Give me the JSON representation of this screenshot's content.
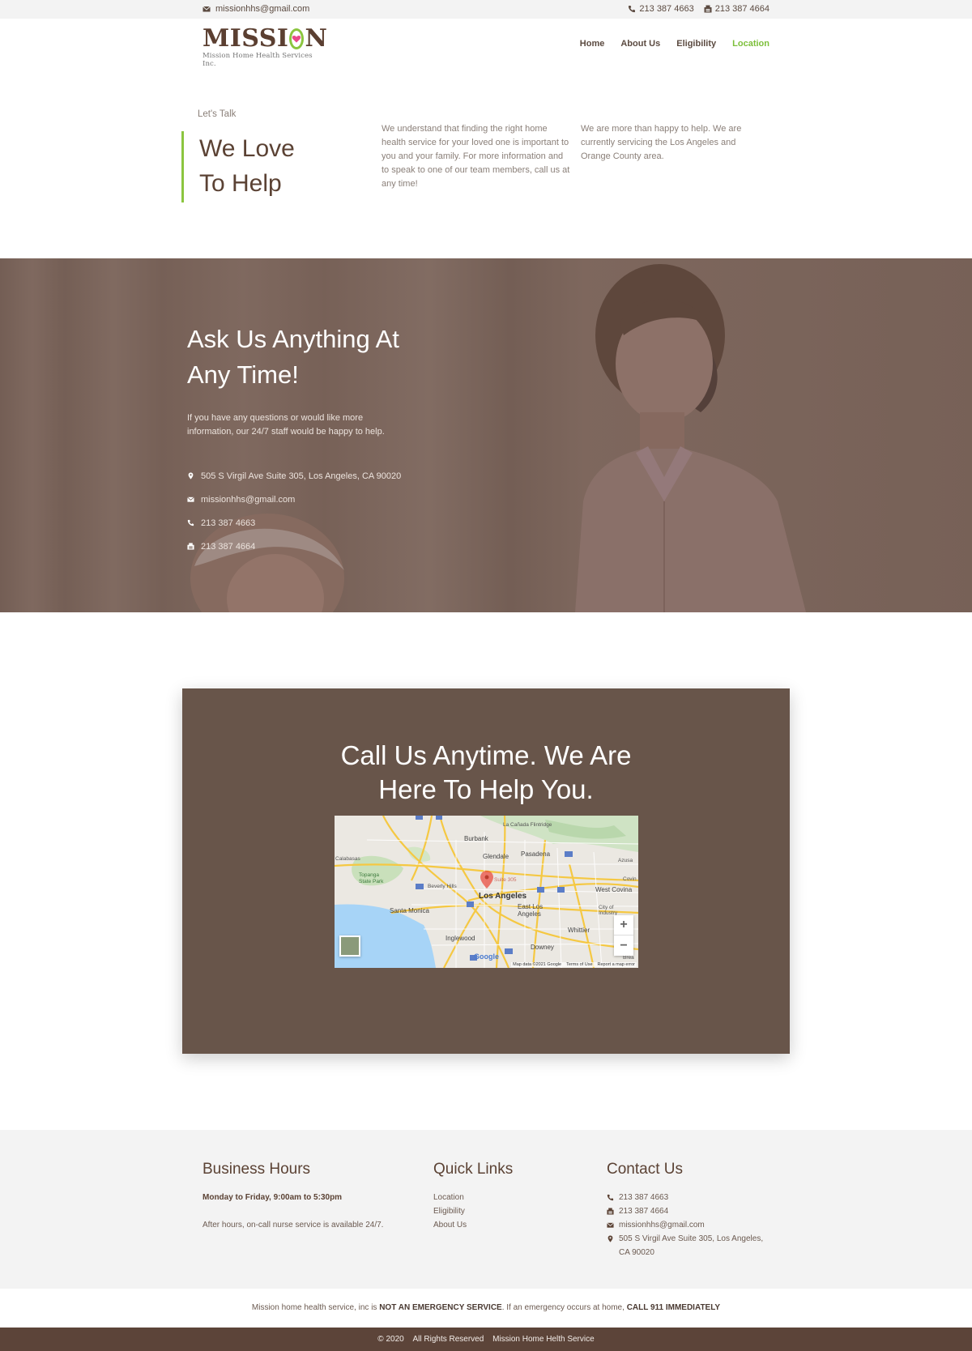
{
  "topbar": {
    "email": "missionhhs@gmail.com",
    "phone": "213 387 4663",
    "fax": "213 387 4664"
  },
  "header": {
    "logo_word_left": "MISSI",
    "logo_word_right": "N",
    "logo_tagline": "Mission Home Health Services Inc.",
    "nav": [
      {
        "label": "Home"
      },
      {
        "label": "About Us"
      },
      {
        "label": "Eligibility"
      },
      {
        "label": "Location"
      }
    ],
    "active_nav": "Location"
  },
  "intro": {
    "eyebrow": "Let's Talk",
    "title_line1": "We Love",
    "title_line2": "To Help",
    "col1": "We understand that finding the right home health service for your loved one is important to you and your family. For more information and to speak to one of our team members, call us at any time!",
    "col2": "We are more than happy to help. We are currently servicing the Los Angeles and Orange County area."
  },
  "hero": {
    "heading_line1": "Ask Us Anything At",
    "heading_line2": "Any Time!",
    "description": "If you have any questions or would like more information, our 24/7 staff would be happy to help.",
    "address": "505 S Virgil Ave Suite 305, Los Angeles, CA 90020",
    "email": "missionhhs@gmail.com",
    "phone": "213 387 4663",
    "fax": "213 387 4664"
  },
  "call": {
    "heading_line1": "Call Us Anytime. We Are",
    "heading_line2": "Here To Help You.",
    "map": {
      "labels": {
        "la_canada": "La Cañada Flintridge",
        "burbank": "Burbank",
        "glendale": "Glendale",
        "pasadena": "Pasadena",
        "calabasas": "Calabasas",
        "azusa": "Azusa",
        "topanga": "Topanga State Park",
        "beverly_hills": "Beverly Hills",
        "suite": "Suite 305",
        "covina": "Covin",
        "west_covina": "West Covina",
        "los_angeles": "Los Angeles",
        "santa_monica": "Santa Monica",
        "east_la": "East Los Angeles",
        "city_industry": "City of Industry",
        "inglewood": "Inglewood",
        "whittier": "Whittier",
        "downey": "Downey",
        "brea": "Brea"
      },
      "zoom_in": "+",
      "zoom_out": "−",
      "google": "Google",
      "attribution": [
        "Map data ©2021 Google",
        "Terms of Use",
        "Report a map error"
      ]
    }
  },
  "footer": {
    "hours_title": "Business Hours",
    "hours_main": "Monday to Friday, 9:00am to 5:30pm",
    "hours_note": "After hours, on-call nurse service is available 24/7.",
    "links_title": "Quick Links",
    "links": [
      {
        "label": "Location"
      },
      {
        "label": "Eligibility"
      },
      {
        "label": "About Us"
      }
    ],
    "contact_title": "Contact Us",
    "contact_phone": "213 387 4663",
    "contact_fax": "213 387 4664",
    "contact_email": "missionhhs@gmail.com",
    "contact_address_line1": "505 S Virgil Ave Suite 305, Los Angeles,",
    "contact_address_line2": "CA 90020"
  },
  "disclaimer": {
    "part1": "Mission home health service, inc is ",
    "bold1": "NOT AN EMERGENCY SERVICE",
    "part2": ". If an emergency occurs at home, ",
    "bold2": "CALL 911 IMMEDIATELY"
  },
  "copyright": {
    "year": "© 2020",
    "rights": "All Rights Reserved",
    "company": "Mission Home Helth Service"
  },
  "colors": {
    "brand_brown": "#5b4234",
    "accent_green": "#8bc53f",
    "card_brown": "#68554a",
    "footer_bar": "#5c4439"
  }
}
